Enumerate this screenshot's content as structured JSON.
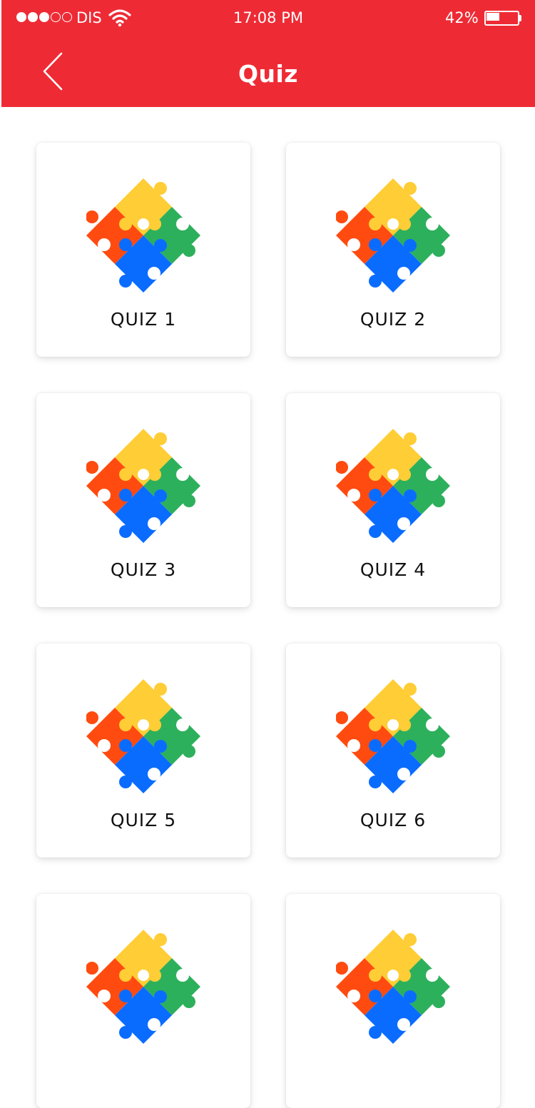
{
  "status_bar": {
    "carrier": "DIS",
    "time": "17:08 PM",
    "battery_percent": "42%",
    "battery_level": 0.42,
    "signal_bars_filled": 3,
    "signal_bars_total": 5
  },
  "header": {
    "title": "Quiz",
    "back_icon": "chevron-left-icon",
    "background_color": "#ee2b35"
  },
  "quizzes": [
    {
      "label": "QUIZ 1",
      "icon": "puzzle-icon"
    },
    {
      "label": "QUIZ 2",
      "icon": "puzzle-icon"
    },
    {
      "label": "QUIZ 3",
      "icon": "puzzle-icon"
    },
    {
      "label": "QUIZ 4",
      "icon": "puzzle-icon"
    },
    {
      "label": "QUIZ 5",
      "icon": "puzzle-icon"
    },
    {
      "label": "QUIZ 6",
      "icon": "puzzle-icon"
    },
    {
      "label": "",
      "icon": "puzzle-icon"
    },
    {
      "label": "",
      "icon": "puzzle-icon"
    }
  ],
  "puzzle_colors": {
    "yellow": "#ffcd35",
    "green": "#2db05c",
    "red": "#ff4b10",
    "blue": "#0a6cff"
  }
}
